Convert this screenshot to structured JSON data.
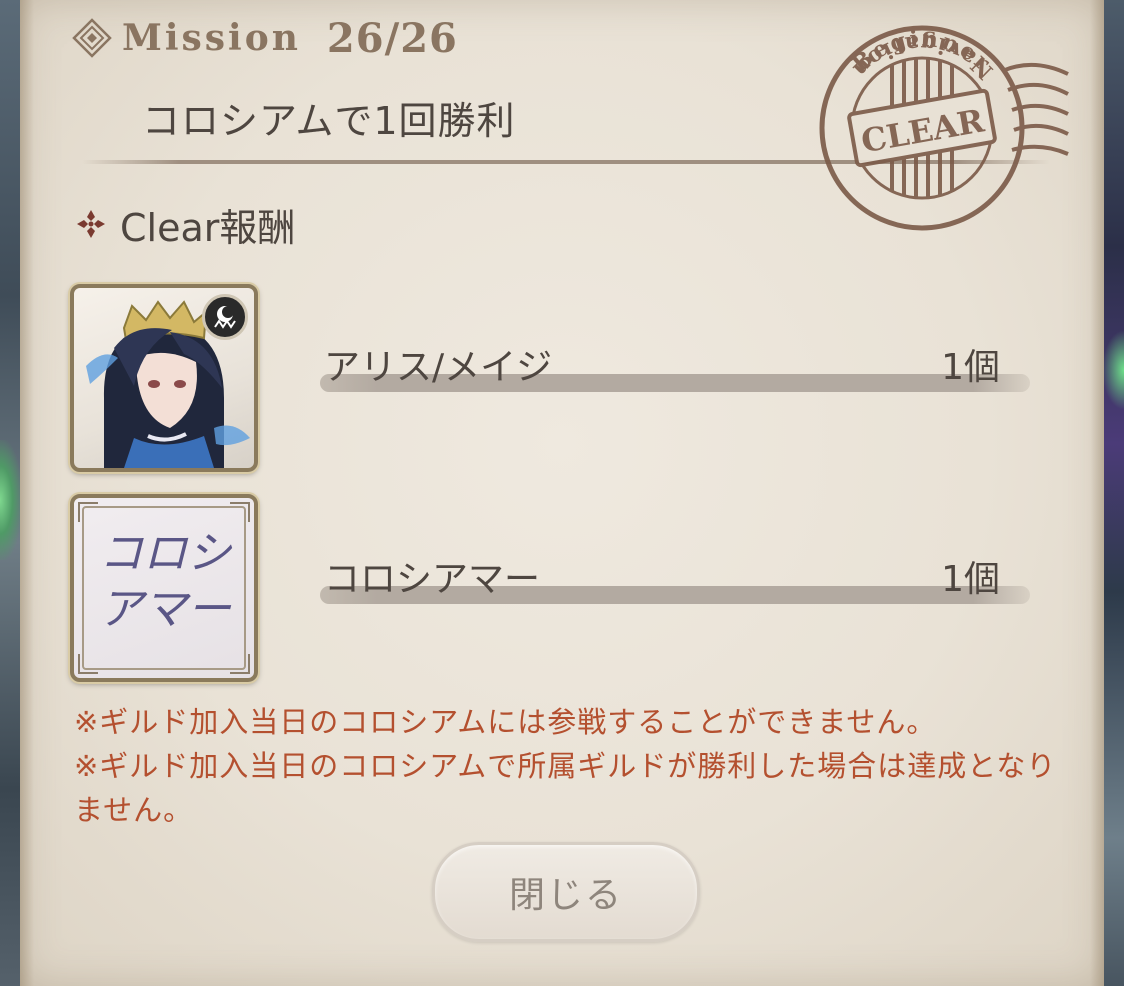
{
  "mission": {
    "icon": "diamond-ornament-icon",
    "label": "Mission",
    "count": "26/26",
    "title": "コロシアムで1回勝利"
  },
  "stamp": {
    "icon": "clear-stamp-icon",
    "top_text": "Beginner",
    "center_text": "CLEAR",
    "bottom_text": "Navigation",
    "color": "#7b5a48"
  },
  "rewards": {
    "header_icon": "cross-ornament-icon",
    "header_label": "Clear報酬",
    "items": [
      {
        "name": "アリス/メイジ",
        "quantity": "1個",
        "icon": "character-portrait-icon"
      },
      {
        "name": "コロシアマー",
        "quantity": "1個",
        "icon": "title-card-icon",
        "card_text": "コロシアマー"
      }
    ]
  },
  "notes": [
    "※ギルド加入当日のコロシアムには参戦することができません。",
    "※ギルド加入当日のコロシアムで所属ギルドが勝利した場合は達成となりません。"
  ],
  "close_button": {
    "label": "閉じる"
  },
  "colors": {
    "paper": "#e9e2d6",
    "accent_brown": "#8a7561",
    "text_dark": "#4e4640",
    "note_red": "#b4502f"
  }
}
